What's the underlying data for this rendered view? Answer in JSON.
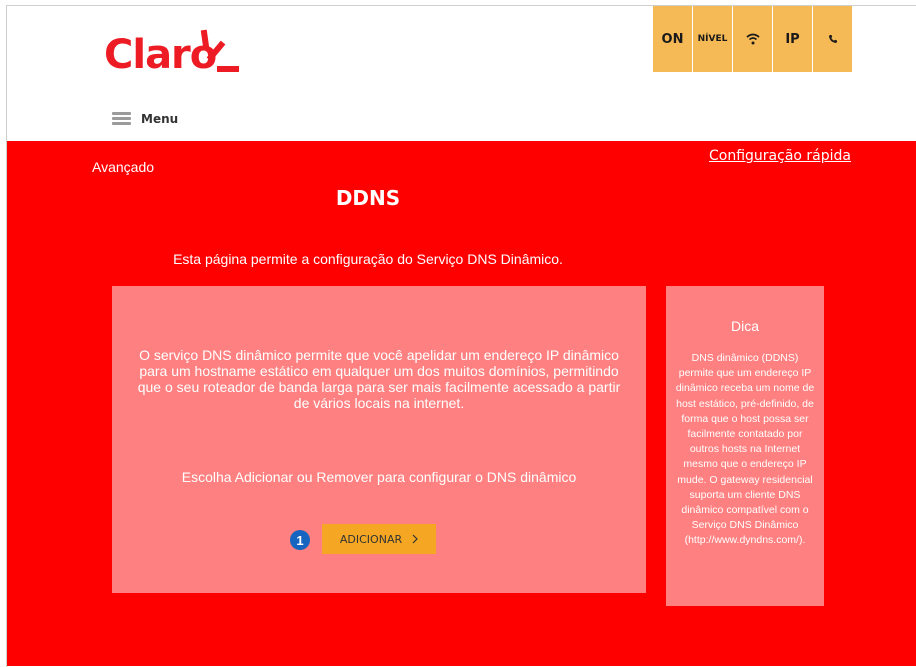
{
  "brand": {
    "logo_text": "Claro",
    "accent": "#ed1c24"
  },
  "header": {
    "menu_label": "Menu",
    "status": [
      "ON",
      "NÍVEL",
      "wifi-icon",
      "IP",
      "phone-icon"
    ]
  },
  "status_bar": {
    "on": "ON",
    "nivel": "NÍVEL",
    "ip": "IP",
    "color": "#f5b955"
  },
  "breadcrumb": "Avançado",
  "quick_link": "Configuração rápida",
  "page": {
    "title": "DDNS",
    "subtitle": "Esta página permite a configuração do Serviço DNS Dinâmico.",
    "description": "O serviço DNS dinâmico permite que você apelidar um endereço IP dinâmico para um hostname estático em qualquer um dos muitos domínios, permitindo que o seu roteador de banda larga para ser mais facilmente acessado a partir de vários locais na internet.",
    "instruction": "Escolha Adicionar ou Remover para configurar o DNS dinâmico",
    "step": "1",
    "add_button": "ADICIONAR"
  },
  "tip": {
    "title": "Dica",
    "text": "DNS dinâmico (DDNS) permite que um endereço IP dinâmico receba um nome de host estático, pré-definido, de forma que o host possa ser facilmente contatado por outros hosts na Internet mesmo que o endereço IP mude. O gateway residencial suporta um cliente DNS dinâmico compatível com o Serviço DNS Dinâmico (http://www.dyndns.com/)."
  },
  "colors": {
    "background": "#ff0000",
    "panel": "#ff8080",
    "button": "#f5a623",
    "badge": "#1565c0"
  }
}
